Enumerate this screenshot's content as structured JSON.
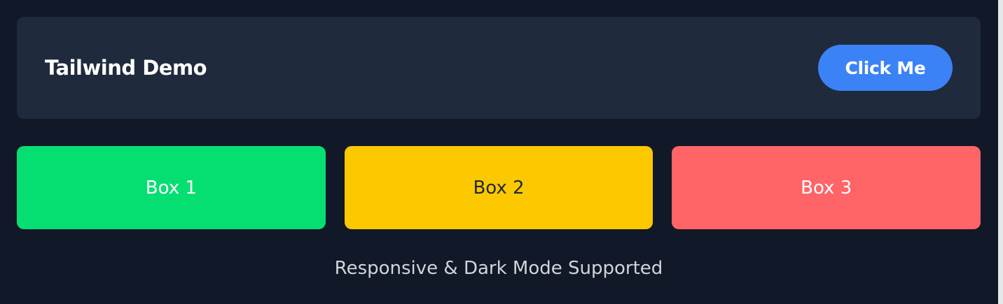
{
  "header": {
    "title": "Tailwind Demo",
    "button_label": "Click Me"
  },
  "boxes": [
    {
      "label": "Box 1",
      "color": "#05df72"
    },
    {
      "label": "Box 2",
      "color": "#fcc800"
    },
    {
      "label": "Box 3",
      "color": "#ff6467"
    }
  ],
  "footer": {
    "text": "Responsive & Dark Mode Supported"
  },
  "theme": {
    "background": "#111827",
    "card": "#1f2a3c",
    "accent": "#3b82f6"
  }
}
